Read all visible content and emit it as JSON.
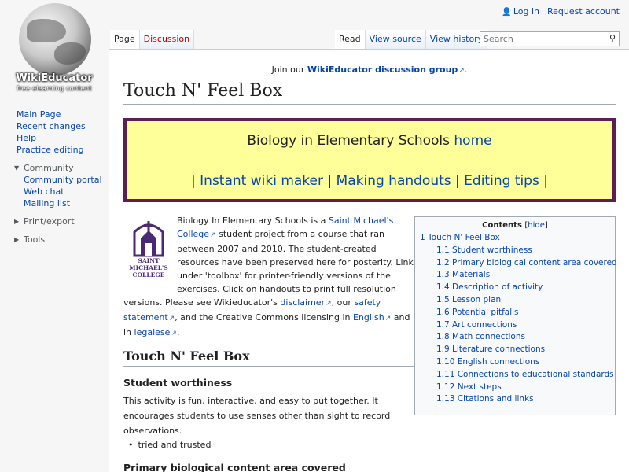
{
  "logo": {
    "wordmark": "WikiEducator",
    "tagline": "free elearning content"
  },
  "personal": {
    "login": "Log in",
    "request": "Request account"
  },
  "tabs": {
    "left": [
      {
        "label": "Page",
        "selected": true
      },
      {
        "label": "Discussion",
        "new": true
      }
    ],
    "right": [
      {
        "label": "Read",
        "selected": true
      },
      {
        "label": "View source"
      },
      {
        "label": "View history"
      }
    ]
  },
  "search": {
    "placeholder": "Search"
  },
  "sidebar": {
    "nav": [
      "Main Page",
      "Recent changes",
      "Help",
      "Practice editing"
    ],
    "community": {
      "title": "Community",
      "items": [
        "Community portal",
        "Web chat",
        "Mailing list"
      ]
    },
    "print": "Print/export",
    "tools": "Tools"
  },
  "sitenotice": {
    "before": "Join our ",
    "link": "WikiEducator discussion group",
    "after": "."
  },
  "title": "Touch N' Feel Box",
  "banner": {
    "line1_text": "Biology in Elementary Schools ",
    "line1_link": "home",
    "sep": "|",
    "links": [
      "Instant wiki maker",
      "Making handouts",
      "Editing tips"
    ]
  },
  "college_logo": {
    "name_lines": [
      "SAINT",
      "MICHAEL'S",
      "COLLEGE"
    ]
  },
  "intro": {
    "t1": "Biology In Elementary Schools is a ",
    "l1": "Saint Michael's College",
    "t2": " student project from a course that ran between 2007 and 2010. The student-created resources have been preserved here for posterity. Link under 'toolbox' for printer-friendly versions of the exercises. Click on handouts to print full resolution versions. Please see Wikieducator's ",
    "l2": "disclaimer",
    "t3": ", our ",
    "l3": "safety statement",
    "t4": ", and the Creative Commons licensing in ",
    "l4": "English",
    "t5": " and in ",
    "l5": "legalese",
    "t6": "."
  },
  "toc": {
    "title": "Contents",
    "hide": "hide",
    "items": [
      {
        "label": "1 Touch N' Feel Box",
        "level": 1
      },
      {
        "label": "1.1 Student worthiness",
        "level": 2
      },
      {
        "label": "1.2 Primary biological content area covered",
        "level": 2
      },
      {
        "label": "1.3 Materials",
        "level": 2
      },
      {
        "label": "1.4 Description of activity",
        "level": 2
      },
      {
        "label": "1.5 Lesson plan",
        "level": 2
      },
      {
        "label": "1.6 Potential pitfalls",
        "level": 2
      },
      {
        "label": "1.7 Art connections",
        "level": 2
      },
      {
        "label": "1.8 Math connections",
        "level": 2
      },
      {
        "label": "1.9 Literature connections",
        "level": 2
      },
      {
        "label": "1.10 English connections",
        "level": 2
      },
      {
        "label": "1.11 Connections to educational standards",
        "level": 2
      },
      {
        "label": "1.12 Next steps",
        "level": 2
      },
      {
        "label": "1.13 Citations and links",
        "level": 2
      }
    ]
  },
  "section": {
    "heading": "Touch N' Feel Box",
    "sub1": "Student worthiness",
    "para1": "This activity is fun, interactive, and easy to put together. It encourages students to use senses other than sight to record observations.",
    "bullet1": "tried and trusted",
    "sub2": "Primary biological content area covered"
  },
  "colors": {
    "banner_bg": "#ffff99",
    "banner_border": "#5f1e50",
    "link": "#0645ad",
    "new_link": "#ba0000"
  }
}
